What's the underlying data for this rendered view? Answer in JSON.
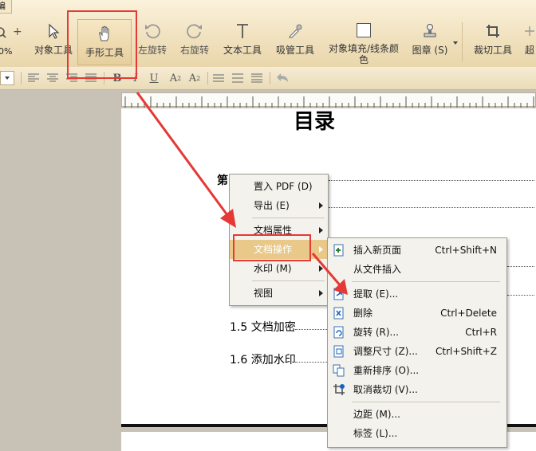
{
  "ribbon": {
    "tab_edit": "编辑",
    "zoom_fragment": "0%",
    "tools": [
      {
        "label": "对象工具",
        "icon": "arrow-cursor-icon"
      },
      {
        "label": "手形工具",
        "icon": "hand-icon"
      },
      {
        "label": "左旋转",
        "icon": "rotate-left-icon"
      },
      {
        "label": "右旋转",
        "icon": "rotate-right-icon"
      },
      {
        "label": "文本工具",
        "icon": "text-tool-icon"
      },
      {
        "label": "吸管工具",
        "icon": "eyedropper-icon"
      },
      {
        "label": "对象填充/线条颜",
        "label2": "色",
        "icon": "fill-color-icon"
      },
      {
        "label": "图章 (S)",
        "icon": "stamp-icon"
      },
      {
        "label": "裁切工具",
        "icon": "crop-icon"
      },
      {
        "label": "超",
        "icon": "more-icon"
      }
    ]
  },
  "formatbar": {
    "bold": "B",
    "italic": "I",
    "underline": "U",
    "superscript": "A",
    "superscript_sup": "2",
    "subscript": "A",
    "subscript_sub": "2"
  },
  "document": {
    "title": "目录",
    "heading_fragment": "第",
    "toc": [
      {
        "text": "1.5 文档加密"
      },
      {
        "text": "1.6 添加水印"
      }
    ]
  },
  "context_menu": {
    "items": [
      {
        "label": "置入 PDF (D)"
      },
      {
        "label": "导出 (E)"
      },
      {
        "label": "文档属性"
      },
      {
        "label": "文档操作"
      },
      {
        "label": "水印 (M)"
      },
      {
        "label": "视图"
      }
    ]
  },
  "submenu": {
    "items": [
      {
        "label": "插入新页面",
        "shortcut": "Ctrl+Shift+N",
        "icon": "insert-page-icon"
      },
      {
        "label": "从文件插入",
        "shortcut": "",
        "icon": ""
      },
      {
        "label": "提取 (E)...",
        "shortcut": "",
        "icon": "extract-page-icon"
      },
      {
        "label": "删除",
        "shortcut": "Ctrl+Delete",
        "icon": "delete-page-icon"
      },
      {
        "label": "旋转 (R)...",
        "shortcut": "Ctrl+R",
        "icon": "rotate-page-icon"
      },
      {
        "label": "调整尺寸 (Z)...",
        "shortcut": "Ctrl+Shift+Z",
        "icon": "resize-page-icon"
      },
      {
        "label": "重新排序 (O)...",
        "shortcut": "",
        "icon": "reorder-pages-icon"
      },
      {
        "label": "取消裁切 (V)...",
        "shortcut": "",
        "icon": "uncrop-icon"
      },
      {
        "label": "边距 (M)...",
        "shortcut": "",
        "icon": ""
      },
      {
        "label": "标签 (L)...",
        "shortcut": "",
        "icon": ""
      }
    ]
  },
  "colors": {
    "ribbon_bg": "#f1e2bf",
    "menu_highlight": "#e9c98a",
    "annotation_red": "#e53935"
  }
}
